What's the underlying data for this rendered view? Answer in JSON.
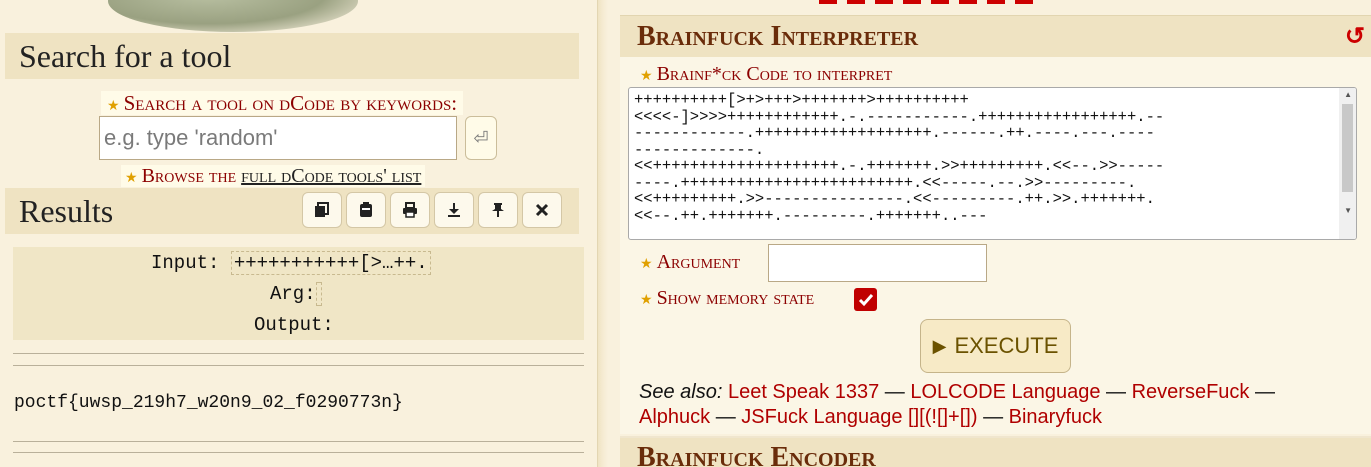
{
  "left": {
    "search_title": "Search for a tool",
    "search_label": "Search a tool on dCode by keywords:",
    "search_placeholder": "e.g. type 'random'",
    "search_go_icon": "enter-icon",
    "browse_prefix": "Browse the ",
    "browse_link": "full dCode tools' list",
    "results_title": "Results",
    "toolbar_icons": [
      "copy-icon",
      "clipboard-icon",
      "print-icon",
      "download-icon",
      "pin-icon",
      "close-icon"
    ],
    "result": {
      "input_label": "Input:",
      "input_value": "+++++++++++[>…++.",
      "arg_label": "Arg:",
      "output_label": "Output:"
    },
    "flag": "poctf{uwsp_219h7_w20n9_02_f0290773n}"
  },
  "right": {
    "interpreter_title": "Brainfuck Interpreter",
    "code_label": "Brainf*ck Code to interpret",
    "code_lines": [
      "++++++++++[>+>+++>+++++++>++++++++++",
      "<<<<-]>>>>++++++++++++.-.-----------.+++++++++++++++++.--",
      "------------.+++++++++++++++++++.------.++.----.---.----",
      "-------------.",
      "<<++++++++++++++++++++.-.+++++++.>>+++++++++.<<--.>>-----",
      "----.+++++++++++++++++++++++++.<<-----.--.>>---------.",
      "<<+++++++++.>>---------------.<<---------.++.>>.+++++++.",
      "<<--.++.+++++++.---------.+++++++..---"
    ],
    "argument_label": "Argument",
    "argument_value": "",
    "memory_label": "Show memory state",
    "memory_checked": true,
    "execute_label": "EXECUTE",
    "see_also_label": "See also:",
    "see_also": [
      "Leet Speak 1337",
      "LOLCODE Language",
      "ReverseFuck",
      "Alphuck",
      "JSFuck Language [][(![]+[])",
      "Binaryfuck"
    ],
    "see_also_sep": " — ",
    "encoder_title": "Brainfuck Encoder"
  },
  "colors": {
    "accent_red": "#8c0000",
    "heading_brown": "#6a2c0a",
    "background": "#f9f1dd",
    "panel": "#efe3c2"
  }
}
